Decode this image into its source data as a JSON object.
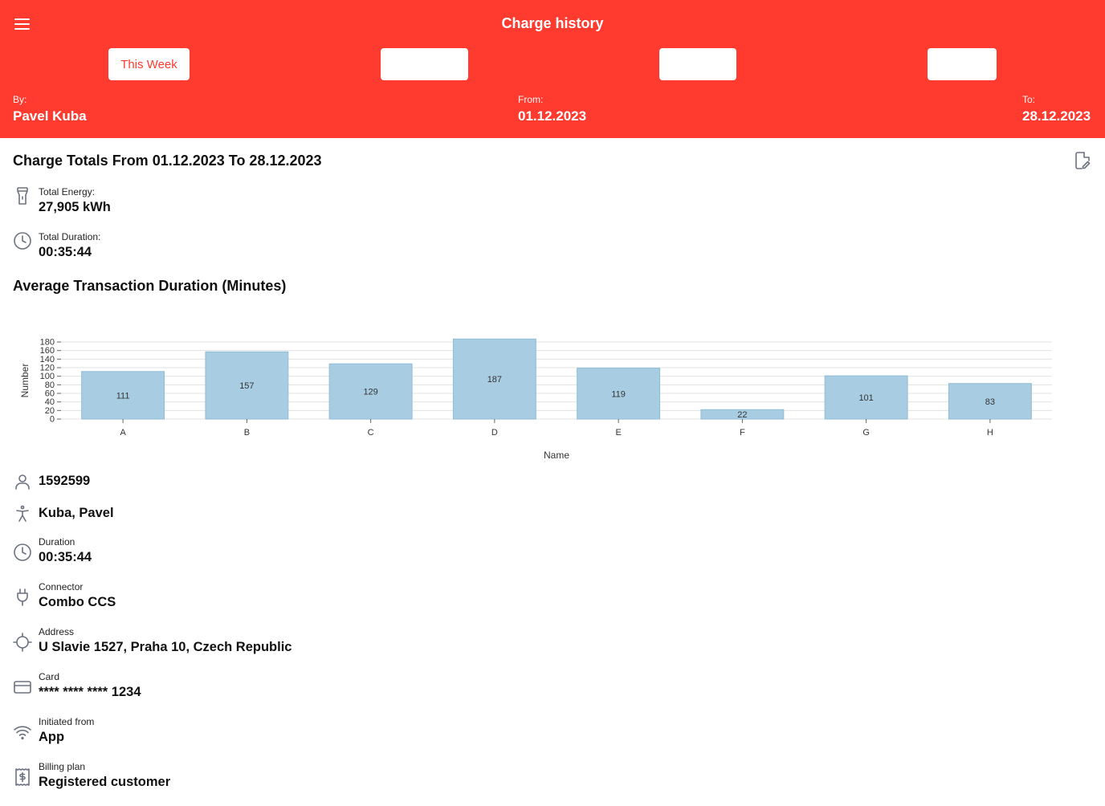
{
  "header": {
    "title": "Charge history",
    "period_buttons": [
      {
        "label": "This Week",
        "active": true
      },
      {
        "label": "",
        "active": false
      },
      {
        "label": "",
        "active": false
      },
      {
        "label": "",
        "active": false
      }
    ],
    "by_label": "By:",
    "by_value": "Pavel Kuba",
    "from_label": "From:",
    "from_value": "01.12.2023",
    "to_label": "To:",
    "to_value": "28.12.2023"
  },
  "totals": {
    "title": "Charge Totals From 01.12.2023 To 28.12.2023",
    "energy_label": "Total Energy:",
    "energy_value": "27,905 kWh",
    "duration_label": "Total Duration:",
    "duration_value": "00:35:44"
  },
  "chart_section": {
    "title": "Average Transaction Duration (Minutes)"
  },
  "chart_data": {
    "type": "bar",
    "categories": [
      "A",
      "B",
      "C",
      "D",
      "E",
      "F",
      "G",
      "H"
    ],
    "values": [
      111,
      157,
      129,
      187,
      119,
      22,
      101,
      83
    ],
    "xlabel": "Name",
    "ylabel": "Number",
    "ylim": [
      0,
      180
    ],
    "yticks": [
      0,
      20,
      40,
      60,
      80,
      100,
      120,
      140,
      160,
      180
    ],
    "grid": true,
    "bar_color": "#a8cde2"
  },
  "details": {
    "id_value": "1592599",
    "name_value": "Kuba, Pavel",
    "duration_label": "Duration",
    "duration_value": "00:35:44",
    "connector_label": "Connector",
    "connector_value": "Combo CCS",
    "address_label": "Address",
    "address_value": "U Slavie 1527, Praha 10, Czech Republic",
    "card_label": "Card",
    "card_value": "**** **** **** 1234",
    "initiated_label": "Initiated from",
    "initiated_value": "App",
    "billing_label": "Billing plan",
    "billing_value": "Registered customer"
  },
  "icons": {
    "menu": "menu-icon",
    "export": "export-pdf-icon",
    "energy": "flashlight-icon",
    "duration": "clock-icon",
    "user": "person-icon",
    "name": "accessibility-icon",
    "connector": "plug-icon",
    "address": "crosshair-icon",
    "card": "credit-card-icon",
    "initiated": "wifi-icon",
    "billing": "receipt-icon"
  },
  "colors": {
    "brand": "#ff3b30",
    "icon": "#6b7280"
  }
}
